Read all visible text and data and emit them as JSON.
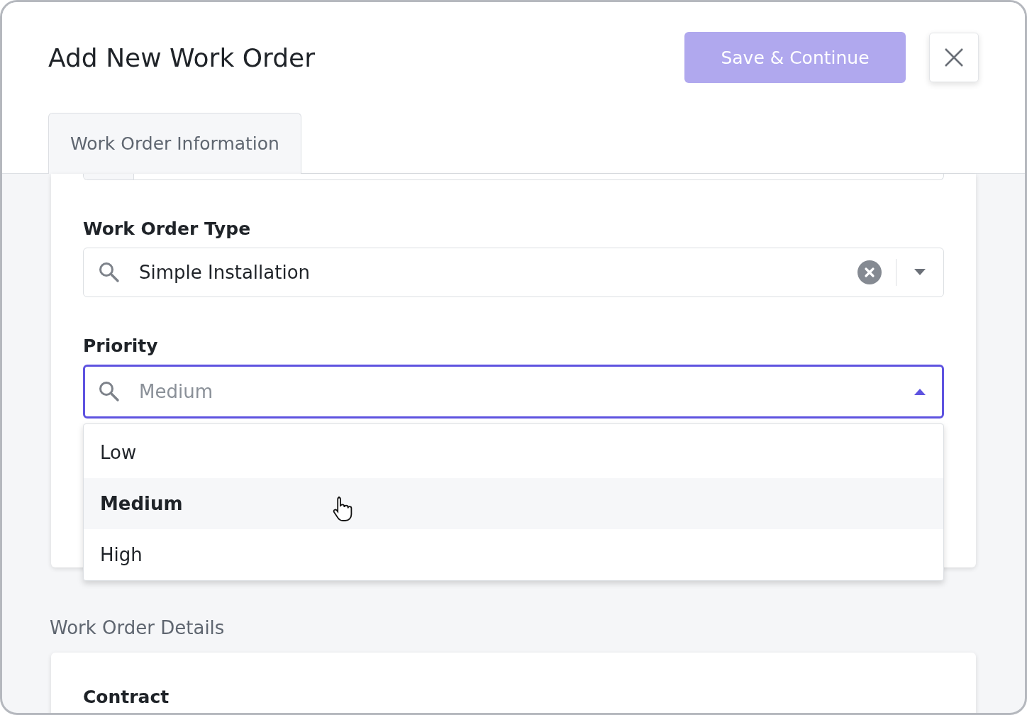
{
  "dialog": {
    "title": "Add New Work Order",
    "save_button": {
      "label": "Save & Continue",
      "disabled": true
    }
  },
  "tabs": [
    {
      "label": "Work Order Information",
      "selected": true
    }
  ],
  "fields": [
    {
      "label": "Work Order Type",
      "value": "Simple Installation",
      "clearable": true,
      "open": false
    },
    {
      "label": "Priority",
      "placeholder": "Medium",
      "open": true,
      "options": [
        {
          "label": "Low",
          "selected": false
        },
        {
          "label": "Medium",
          "selected": true
        },
        {
          "label": "High",
          "selected": false
        }
      ]
    }
  ],
  "sections": [
    {
      "title": "Work Order Details",
      "fields": [
        {
          "label": "Contract"
        }
      ]
    }
  ]
}
